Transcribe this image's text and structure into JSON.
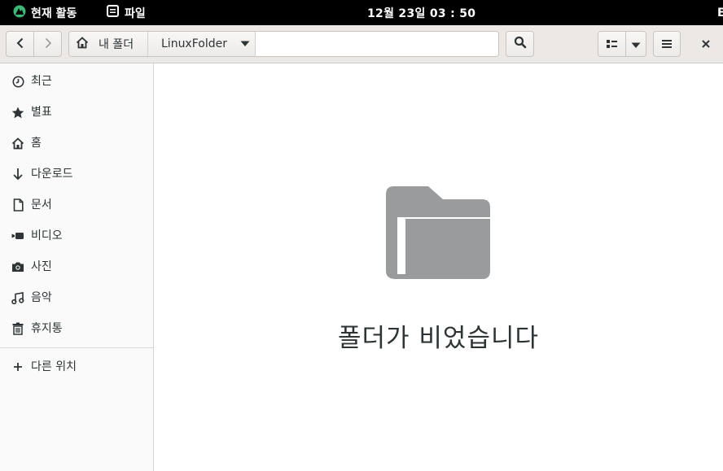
{
  "topbar": {
    "activities_label": "현재 활동",
    "app_label": "파일",
    "clock": "12월 23일  03 : 50",
    "right_glyph": "E"
  },
  "header": {
    "path": {
      "home_label": "내 폴더",
      "current_label": "LinuxFolder"
    }
  },
  "sidebar": {
    "items": [
      {
        "label": "최근",
        "icon": "clock-icon"
      },
      {
        "label": "별표",
        "icon": "star-icon"
      },
      {
        "label": "홈",
        "icon": "home-icon"
      },
      {
        "label": "다운로드",
        "icon": "download-icon"
      },
      {
        "label": "문서",
        "icon": "document-icon"
      },
      {
        "label": "비디오",
        "icon": "video-icon"
      },
      {
        "label": "사진",
        "icon": "camera-icon"
      },
      {
        "label": "음악",
        "icon": "music-icon"
      },
      {
        "label": "휴지통",
        "icon": "trash-icon"
      }
    ],
    "other_locations": {
      "label": "다른 위치",
      "icon": "plus-icon"
    }
  },
  "main": {
    "empty_message": "폴더가 비었습니다",
    "empty_icon": "folder-icon",
    "empty_icon_color": "#9a9b9c"
  }
}
